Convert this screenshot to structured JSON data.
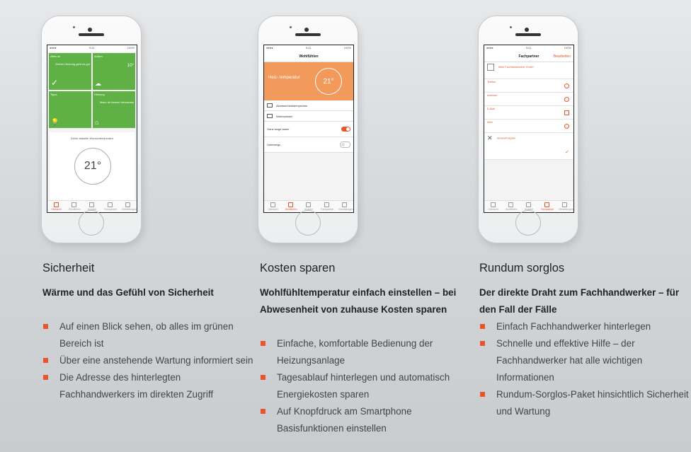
{
  "columns": [
    {
      "title": "Sicherheit",
      "subtitle": "Wärme und das Gefühl von Sicherheit",
      "bullets": [
        "Auf einen Blick sehen, ob alles im grünen Bereich ist",
        "Über eine anstehende Wartung informiert sein",
        "Die Adresse des hinterlegten Fachhandwerkers im direkten Zugriff"
      ]
    },
    {
      "title": "Kosten sparen",
      "subtitle": "Wohlfühltemperatur einfach einstellen – bei Abwesenheit von zuhause Kosten sparen",
      "bullets": [
        "Einfache, komfortable Bedienung der Heizungsanlage",
        "Tagesablauf hinterlegen und automatisch Energiekosten sparen",
        "Auf Knopfdruck am Smartphone Basisfunktionen einstellen"
      ]
    },
    {
      "title": "Rundum sorglos",
      "subtitle": "Der direkte Draht zum Fachhandwerker – für den Fall der Fälle",
      "bullets": [
        "Einfach Fachhandwerker hinterlegen",
        "Schnelle und effektive Hilfe – der Fachhandwerker hat alle wichtigen Informationen",
        "Rundum-Sorglos-Paket hinsichtlich Sicherheit und Wartung"
      ]
    }
  ],
  "phone1": {
    "tile1": "Alles ok",
    "tile1_text": "Deiner Heizung geht es gut",
    "tile2": "Außen",
    "tile2_value": "10°",
    "tile3": "Tipps",
    "tile4": "Heizung",
    "tile4_text": "Mach dir keinen Heizstress",
    "card_label": "Deine aktuelle Wunschtemperatur",
    "temperature": "21°"
  },
  "phone2": {
    "header": "Wohlfühlen",
    "label": "Heiz- temperatur",
    "temperature": "21°",
    "row1": "Abwesenheitstemperatur",
    "row2": "Warmwasser",
    "row3": "Ganz lange warm",
    "row4": "Unterwegs"
  },
  "phone3": {
    "header": "Fachpartner",
    "edit": "Bearbeiten",
    "company": "Mein Fachhandwerker GmbH",
    "r1": "Telefon",
    "r2": "Adresse",
    "r3": "E-Mail",
    "r4": "Web",
    "r5": "Servicefreigabe"
  },
  "accent_color": "#e8542c",
  "green_color": "#60b145"
}
